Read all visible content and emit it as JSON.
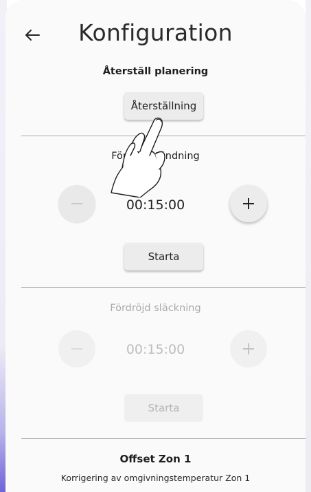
{
  "header": {
    "title": "Konfiguration",
    "back_icon": "arrow-left-icon"
  },
  "reset_section": {
    "label": "Återställ planering",
    "button_label": "Återställning"
  },
  "delayed_on": {
    "label": "Fördröjd tändning",
    "minus_icon": "minus-icon",
    "plus_icon": "plus-icon",
    "time_value": "00:15:00",
    "start_label": "Starta"
  },
  "delayed_off": {
    "label": "Fördröjd släckning",
    "minus_icon": "minus-icon",
    "plus_icon": "plus-icon",
    "time_value": "00:15:00",
    "start_label": "Starta"
  },
  "offset": {
    "title": "Offset Zon 1",
    "subtitle": "Korrigering av omgivningstemperatur Zon 1"
  },
  "overlay": {
    "icon": "tap-hand-icon"
  },
  "colors": {
    "accent": "#6f63d9",
    "surface": "#fafafa",
    "button": "#ececec",
    "divider": "#a8a8a8",
    "disabled_text": "#a9a9a9"
  }
}
